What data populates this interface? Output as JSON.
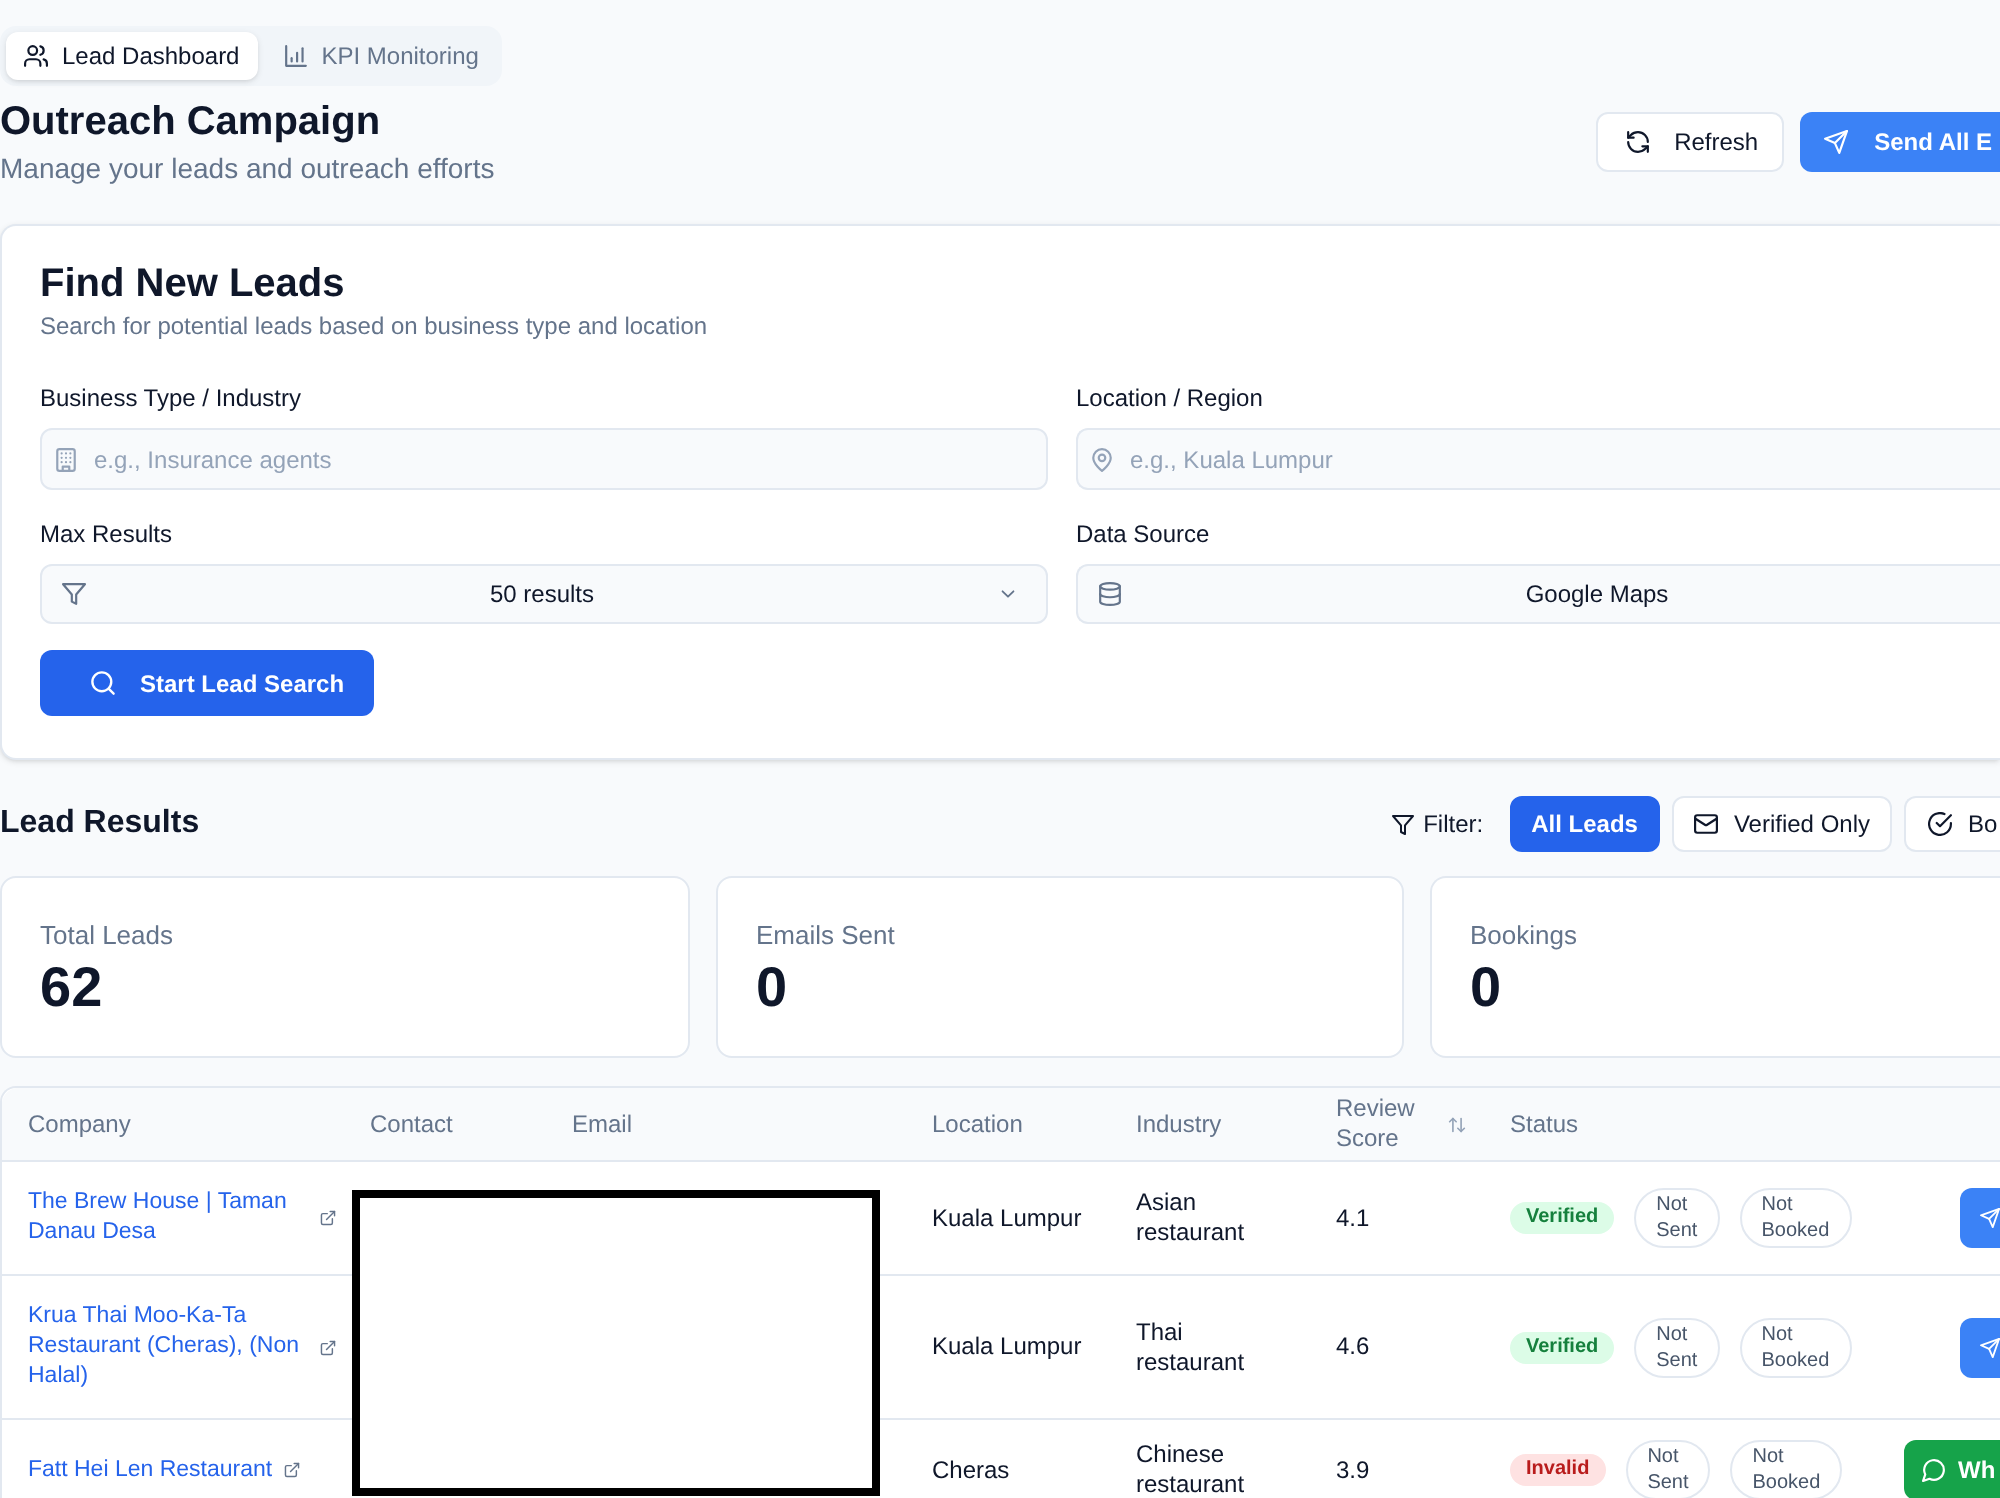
{
  "tabs": [
    {
      "label": "Lead Dashboard",
      "selected": true
    },
    {
      "label": "KPI Monitoring",
      "selected": false
    }
  ],
  "header": {
    "title": "Outreach Campaign",
    "subtitle": "Manage your leads and outreach efforts",
    "buttons": [
      {
        "label": "Refresh",
        "kind": "secondary"
      },
      {
        "label": "Send All E",
        "kind": "primary"
      }
    ]
  },
  "search_card": {
    "title": "Find New Leads",
    "subtitle": "Search for potential leads based on business type and location",
    "fields": [
      {
        "kind": "input",
        "label": "Business Type / Industry",
        "placeholder": "e.g., Insurance agents"
      },
      {
        "kind": "input",
        "label": "Location / Region",
        "placeholder": "e.g., Kuala Lumpur"
      },
      {
        "kind": "select",
        "label": "Max Results",
        "value": "50 results"
      },
      {
        "kind": "select",
        "label": "Data Source",
        "value": "Google Maps"
      }
    ],
    "button": "Start Lead Search"
  },
  "results": {
    "title": "Lead Results",
    "filter_label": "Filter:",
    "filters": [
      {
        "label": "All Leads",
        "selected": true
      },
      {
        "label": "Verified Only",
        "selected": false
      },
      {
        "label": "Bo",
        "selected": false
      }
    ]
  },
  "stats": [
    {
      "label": "Total Leads",
      "value": "62"
    },
    {
      "label": "Emails Sent",
      "value": "0"
    },
    {
      "label": "Bookings",
      "value": "0"
    }
  ],
  "table": {
    "columns": [
      {
        "label": "Company",
        "sortable": false
      },
      {
        "label": "Contact",
        "sortable": false
      },
      {
        "label": "Email",
        "sortable": false
      },
      {
        "label": "Location",
        "sortable": false
      },
      {
        "label": "Industry",
        "sortable": false
      },
      {
        "label": "Review Score",
        "sortable": true
      },
      {
        "label": "Status",
        "sortable": false
      }
    ],
    "rows": [
      {
        "company": "The Brew House | Taman Danau Desa",
        "location": "Kuala Lumpur",
        "industry": "Asian restaurant",
        "review_score": "4.1",
        "verification": {
          "label": "Verified",
          "kind": "verified"
        },
        "email_status": "Not Sent",
        "booking_status": "Not Booked",
        "action": {
          "kind": "send"
        }
      },
      {
        "company": "Krua Thai Moo-Ka-Ta Restaurant (Cheras), (Non Halal)",
        "location": "Kuala Lumpur",
        "industry": "Thai restaurant",
        "review_score": "4.6",
        "verification": {
          "label": "Verified",
          "kind": "verified"
        },
        "email_status": "Not Sent",
        "booking_status": "Not Booked",
        "action": {
          "kind": "send"
        }
      },
      {
        "company": "Fatt Hei Len Restaurant",
        "location": "Cheras",
        "industry": "Chinese restaurant",
        "review_score": "3.9",
        "verification": {
          "label": "Invalid",
          "kind": "invalid"
        },
        "email_status": "Not Sent",
        "booking_status": "Not Booked",
        "action": {
          "kind": "whatsapp",
          "label": "Wh"
        }
      }
    ]
  }
}
